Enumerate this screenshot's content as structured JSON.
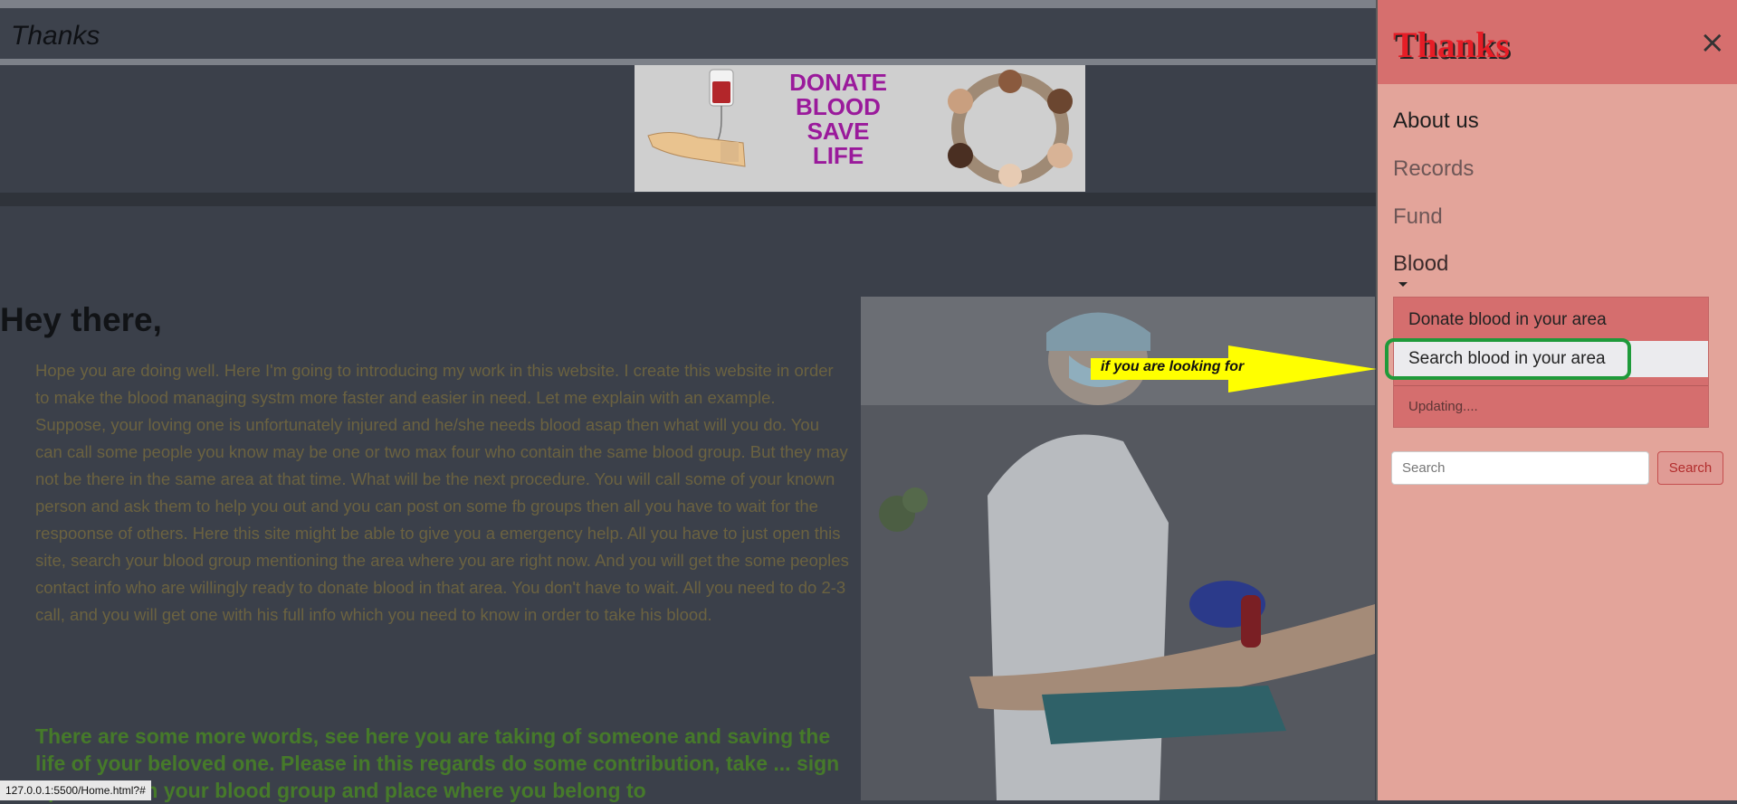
{
  "navbar": {
    "brand": "Thanks"
  },
  "banner": {
    "line1": "DONATE",
    "line2": "BLOOD",
    "line3": "SAVE",
    "line4": "LIFE"
  },
  "main": {
    "heading": "Hey there,",
    "paragraph": "Hope you are doing well. Here I'm going to introducing my work in this website. I create this website in order to make the blood managing systm more faster and easier in need. Let me explain with an example. Suppose, your loving one is unfortunately injured and he/she needs blood asap then what will you do. You can call some people you know may be one or two max four who contain the same blood group. But they may not be there in the same area at that time. What will be the next procedure. You will call some of your known person and ask them to help you out and you can post on some fb groups then all you have to wait for the respoonse of others. Here this site might be able to give you a emergency help. All you have to just open this site, search your blood group mentioning the area where you are right now. And you will get the some peoples contact info who are willingly ready to donate blood in that area. You don't have to wait. All you need to do 2-3 call, and you will get one with his full info which you need to know in order to take his blood.",
    "highlight": "There are some more words, see here you are taking of someone and saving the life of your beloved one. Please in this regards do some contribution, take ... sign up here with your blood group and place where you belong to"
  },
  "annotation": {
    "arrow_text": "if you are looking for",
    "arrow_color": "#ffff00",
    "ring_color": "#1f9a3a"
  },
  "offcanvas": {
    "title": "Thanks",
    "close_icon": "×",
    "links": {
      "about": "About us",
      "records": "Records",
      "fund": "Fund",
      "blood": "Blood"
    },
    "dropdown": {
      "donate": "Donate blood in your area",
      "search": "Search blood in your area",
      "updating": "Updating...."
    },
    "search": {
      "placeholder": "Search",
      "button": "Search"
    }
  },
  "status_bar": {
    "url": "127.0.0.1:5500/Home.html?#"
  }
}
